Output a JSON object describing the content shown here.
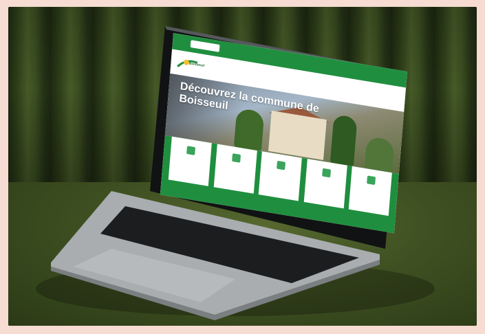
{
  "scene": "laptop-on-table",
  "colors": {
    "background": "#f6dcd2",
    "brand_green": "#1f8f3f",
    "curtain": "#3a4d20",
    "table": "#4b5e27",
    "laptop_body": "#9ea3a6"
  },
  "website": {
    "hero_title": "Découvrez la commune de Boisseuil",
    "logo_name": "Boisseuil",
    "top_links": [
      "",
      "",
      ""
    ],
    "nav_items": [
      "",
      "",
      "",
      "",
      "",
      ""
    ],
    "tiles": [
      {
        "icon": "document-icon",
        "label": ""
      },
      {
        "icon": "megaphone-icon",
        "label": ""
      },
      {
        "icon": "globe-icon",
        "label": ""
      },
      {
        "icon": "book-icon",
        "label": ""
      },
      {
        "icon": "monitor-icon",
        "label": ""
      }
    ]
  }
}
